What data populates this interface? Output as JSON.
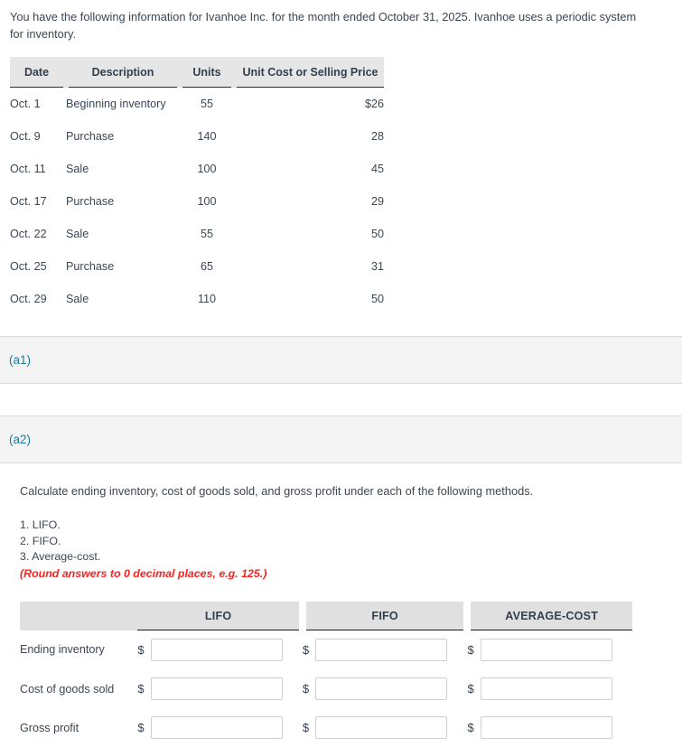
{
  "intro": {
    "text": "You have the following information for Ivanhoe Inc. for the month ended October 31, 2025. Ivanhoe uses a periodic system for inventory."
  },
  "inventory_table": {
    "headers": [
      "Date",
      "Description",
      "Units",
      "Unit Cost or Selling Price"
    ],
    "rows": [
      {
        "date": "Oct. 1",
        "description": "Beginning inventory",
        "units": "55",
        "price": "$26"
      },
      {
        "date": "Oct. 9",
        "description": "Purchase",
        "units": "140",
        "price": "28"
      },
      {
        "date": "Oct. 11",
        "description": "Sale",
        "units": "100",
        "price": "45"
      },
      {
        "date": "Oct. 17",
        "description": "Purchase",
        "units": "100",
        "price": "29"
      },
      {
        "date": "Oct. 22",
        "description": "Sale",
        "units": "55",
        "price": "50"
      },
      {
        "date": "Oct. 25",
        "description": "Purchase",
        "units": "65",
        "price": "31"
      },
      {
        "date": "Oct. 29",
        "description": "Sale",
        "units": "110",
        "price": "50"
      }
    ]
  },
  "sections": {
    "a1": {
      "label": "(a1)"
    },
    "a2": {
      "label": "(a2)",
      "instruction": "Calculate ending inventory, cost of goods sold, and gross profit under each of the following methods.",
      "methods": [
        "1. LIFO.",
        "2. FIFO.",
        "3. Average-cost."
      ],
      "round_note": "(Round answers to 0 decimal places, e.g. 125.)"
    }
  },
  "answer_table": {
    "headers": [
      "",
      "LIFO",
      "FIFO",
      "AVERAGE-COST"
    ],
    "currency_symbol": "$",
    "rows": [
      {
        "label": "Ending inventory",
        "lifo": "",
        "fifo": "",
        "average_cost": ""
      },
      {
        "label": "Cost of goods sold",
        "lifo": "",
        "fifo": "",
        "average_cost": ""
      },
      {
        "label": "Gross profit",
        "lifo": "",
        "fifo": "",
        "average_cost": ""
      }
    ]
  },
  "colors": {
    "link": "#1b7a9e",
    "warning": "#ff2020",
    "header_band": "#e6e6e6",
    "section_band": "#f4f4f4",
    "text": "#3b4652"
  }
}
